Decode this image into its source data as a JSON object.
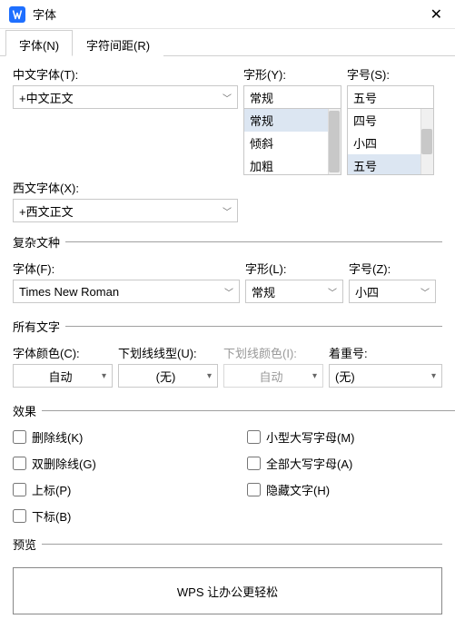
{
  "window": {
    "title": "字体"
  },
  "tabs": {
    "font": "字体(N)",
    "spacing": "字符间距(R)"
  },
  "main": {
    "cnFontLabel": "中文字体(T):",
    "cnFontValue": "+中文正文",
    "styleLabel": "字形(Y):",
    "styleValue": "常规",
    "styleOptions": [
      "常规",
      "倾斜",
      "加粗"
    ],
    "sizeLabel": "字号(S):",
    "sizeValue": "五号",
    "sizeOptions": [
      "四号",
      "小四",
      "五号"
    ],
    "westFontLabel": "西文字体(X):",
    "westFontValue": "+西文正文"
  },
  "complex": {
    "legend": "复杂文种",
    "fontLabel": "字体(F):",
    "fontValue": "Times New Roman",
    "styleLabel": "字形(L):",
    "styleValue": "常规",
    "sizeLabel": "字号(Z):",
    "sizeValue": "小四"
  },
  "allText": {
    "legend": "所有文字",
    "colorLabel": "字体颜色(C):",
    "colorValue": "自动",
    "underlineLabel": "下划线线型(U):",
    "underlineValue": "(无)",
    "underlineColorLabel": "下划线颜色(I):",
    "underlineColorValue": "自动",
    "emphasisLabel": "着重号:",
    "emphasisValue": "(无)"
  },
  "effects": {
    "legend": "效果",
    "strike": "删除线(K)",
    "dblStrike": "双删除线(G)",
    "superscript": "上标(P)",
    "subscript": "下标(B)",
    "smallCaps": "小型大写字母(M)",
    "allCaps": "全部大写字母(A)",
    "hidden": "隐藏文字(H)"
  },
  "preview": {
    "legend": "预览",
    "text": "WPS 让办公更轻松"
  }
}
